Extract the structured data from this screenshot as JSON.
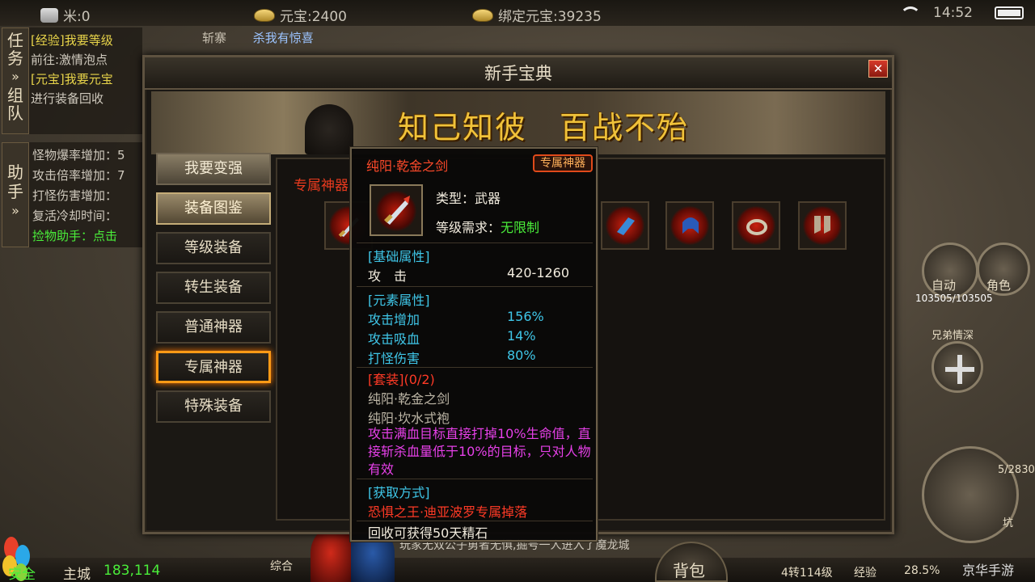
{
  "status_bar": {
    "rice": "米:0",
    "yuanbao": "元宝:2400",
    "bound_yuanbao": "绑定元宝:39235",
    "time": "14:52"
  },
  "quest_panel": {
    "tab_quest": "任务",
    "tab_group": "组队",
    "items": [
      {
        "title": "[经验]我要等级",
        "sub": "前往:激情泡点"
      },
      {
        "title": "[元宝]我要元宝",
        "sub": "进行装备回收"
      }
    ]
  },
  "helper_panel": {
    "tab": "助手",
    "items": [
      "怪物爆率增加：5",
      "攻击倍率增加：7",
      "打怪伤害增加：",
      "复活冷却时间：",
      "捡物助手：点击"
    ]
  },
  "chat": {
    "line1": "斩寨",
    "surprise": "杀我有惊喜"
  },
  "dialog": {
    "title": "新手宝典",
    "close": "✕",
    "banner": "知己知彼　百战不殆",
    "menu": [
      {
        "label": "我要变强",
        "style": "light"
      },
      {
        "label": "装备图鉴",
        "style": "dark2"
      },
      {
        "label": "等级装备",
        "style": "normal"
      },
      {
        "label": "转生装备",
        "style": "normal"
      },
      {
        "label": "普通神器",
        "style": "normal"
      },
      {
        "label": "专属神器",
        "style": "active"
      },
      {
        "label": "特殊装备",
        "style": "normal"
      }
    ],
    "section_label": "专属神器"
  },
  "tooltip": {
    "name": "纯阳·乾金之剑",
    "tag": "专属神器",
    "type_label": "类型：武器",
    "level_label": "等级需求：",
    "level_value": "无限制",
    "base_header": "[基础属性]",
    "attack_label": "攻　击",
    "attack_value": "420-1260",
    "element_header": "[元素属性]",
    "elements": [
      {
        "label": "攻击增加",
        "value": "156%"
      },
      {
        "label": "攻击吸血",
        "value": "14%"
      },
      {
        "label": "打怪伤害",
        "value": "80%"
      }
    ],
    "set_header": "[套装]",
    "set_count": "(0/2)",
    "set_items": [
      "纯阳·乾金之剑",
      "纯阳·坎水式袍"
    ],
    "set_effect": "攻击满血目标直接打掉10%生命值，直接斩杀血量低于10%的目标，只对人物有效",
    "source_header": "[获取方式]",
    "source": "恐惧之王·迪亚波罗专属掉落",
    "recycle": "回收可获得50天精石"
  },
  "right_hud": {
    "auto": "自动",
    "role": "角色",
    "hp": "103505/103505",
    "brother": "兄弟情深",
    "side_num": "5/2830",
    "kan": "坑"
  },
  "bottom_bar": {
    "safe": "安全",
    "city": "主城",
    "coords": "183,114",
    "mix": "综合",
    "chat_msg": "玩家无双公子勇者无惧,掘号一人进入了魔龙城",
    "bag": "背包",
    "level": "4转114级",
    "exp_label": "经验",
    "exp_value": "28.5%",
    "watermark": "京华手游"
  }
}
